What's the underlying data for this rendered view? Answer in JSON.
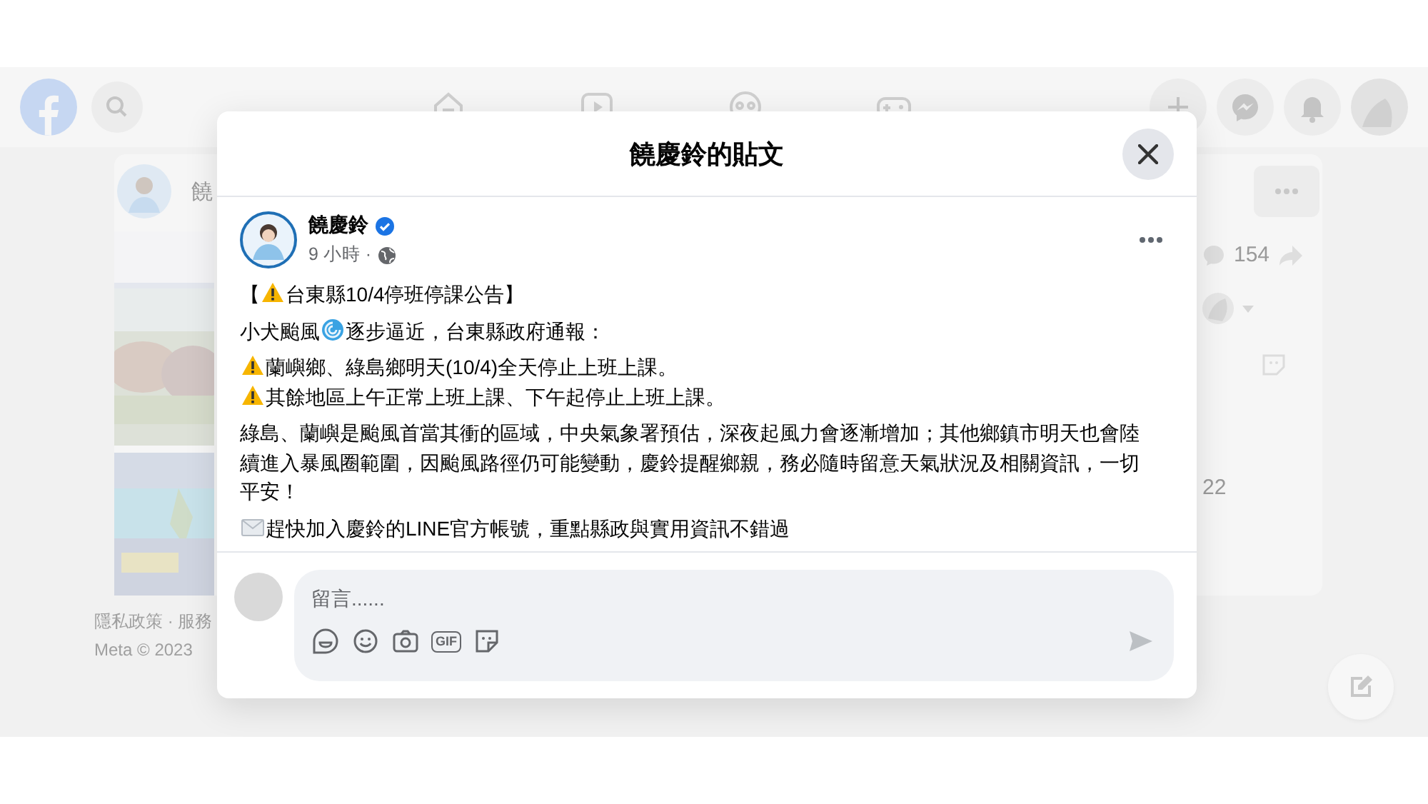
{
  "background_page": {
    "feed_author": "饒",
    "share_count": "154",
    "comment_count": "22",
    "footer_links": "隱私政策 · 服務",
    "footer_copyright": "Meta © 2023"
  },
  "dialog": {
    "title": "饒慶鈴的貼文",
    "post": {
      "author": "饒慶鈴",
      "time": "9 小時 ·",
      "paragraphs": [
        {
          "lines": [
            [
              {
                "kind": "text",
                "text": "【"
              },
              {
                "kind": "warning"
              },
              {
                "kind": "text",
                "text": "台東縣10/4停班停課公告】"
              }
            ]
          ]
        },
        {
          "lines": [
            [
              {
                "kind": "text",
                "text": "小犬颱風"
              },
              {
                "kind": "cyclone"
              },
              {
                "kind": "text",
                "text": "逐步逼近，台東縣政府通報："
              }
            ]
          ]
        },
        {
          "lines": [
            [
              {
                "kind": "warning"
              },
              {
                "kind": "text",
                "text": "蘭嶼鄉、綠島鄉明天(10/4)全天停止上班上課。"
              }
            ],
            [
              {
                "kind": "warning"
              },
              {
                "kind": "text",
                "text": "其餘地區上午正常上班上課、下午起停止上班上課。"
              }
            ]
          ]
        },
        {
          "lines": [
            [
              {
                "kind": "text",
                "text": "綠島、蘭嶼是颱風首當其衝的區域，中央氣象署預估，深夜起風力會逐漸增加；其他鄉鎮市明天也會陸續進入暴風圈範圍，因颱風路徑仍可能變動，慶鈴提醒鄉親，務必隨時留意天氣狀況及相關資訊，一切平安！"
              }
            ]
          ]
        },
        {
          "lines": [
            [
              {
                "kind": "envelope"
              },
              {
                "kind": "text",
                "text": "趕快加入慶鈴的LINE官方帳號，重點縣政與實用資訊不錯過"
              }
            ]
          ]
        }
      ]
    },
    "comment": {
      "placeholder": "留言......",
      "gif_label": "GIF"
    }
  }
}
